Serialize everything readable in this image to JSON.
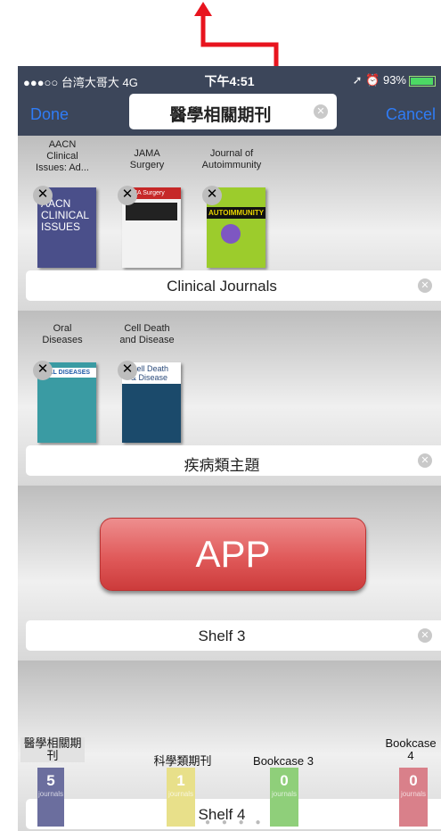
{
  "status_bar": {
    "carrier": "●●●○○ 台湾大哥大  4G",
    "time": "下午4:51",
    "right": "➚ ⏰ 93%"
  },
  "nav": {
    "done": "Done",
    "title": "醫學相關期刊",
    "cancel": "Cancel"
  },
  "shelves": [
    {
      "label": "Clinical Journals",
      "books": [
        {
          "title": "AACN\nClinical\nIssues: Ad...",
          "cover_text": "AACN\nCLINICAL\nISSUES"
        },
        {
          "title": "JAMA\nSurgery",
          "cover_text": "JAMA Surgery"
        },
        {
          "title": "Journal of\nAutoimmunity",
          "cover_text": "AUTOIMMUNITY"
        }
      ]
    },
    {
      "label": "疾病類主題",
      "books": [
        {
          "title": "Oral\nDiseases",
          "cover_text": "ORAL DISEASES"
        },
        {
          "title": "Cell Death\nand Disease",
          "cover_text": "Cell Death\n& Disease"
        }
      ]
    },
    {
      "label": "Shelf 3",
      "app_button": "APP"
    },
    {
      "label": "Shelf 4"
    }
  ],
  "bookcases": [
    {
      "name": "醫學相關期\n刊",
      "count": "5",
      "unit": "journals",
      "color": "#6b6e9e"
    },
    {
      "name": "科學類期刊",
      "count": "1",
      "unit": "journals",
      "color": "#e8e08a"
    },
    {
      "name": "Bookcase 3",
      "count": "0",
      "unit": "journals",
      "color": "#8fcf7a"
    },
    {
      "name": "Bookcase\n4",
      "count": "0",
      "unit": "journals",
      "color": "#d9808a"
    }
  ],
  "colors": {
    "accent": "#2f7cf6",
    "bar": "#3c465a",
    "arrow": "#e8141e"
  }
}
